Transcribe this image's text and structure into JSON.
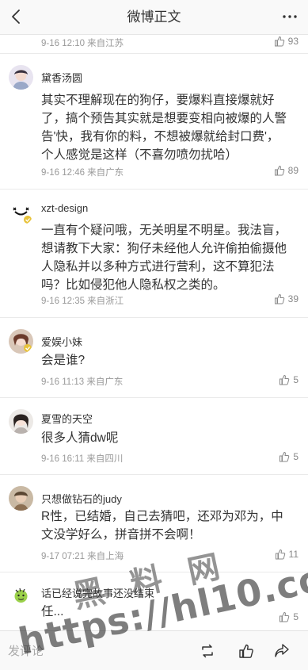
{
  "header": {
    "title": "微博正文",
    "back_icon": "chevron-left-icon",
    "more_icon": "more-dots-icon"
  },
  "partial_comment": {
    "meta": "9-16 12:10 来自江苏",
    "likes": "93"
  },
  "comments": [
    {
      "user": "黛香汤圆",
      "text": "其实不理解现在的狗仔，要爆料直接爆就好\n了，搞个预告其实就是想要变相向被爆的人警\n告'快，我有你的料，不想被爆就给封口费'，\n个人感觉是这样（不喜勿喷勿扰哈）",
      "meta": "9-16 12:46 来自广东",
      "likes": "89"
    },
    {
      "user": "xzt-design",
      "text": "一直有个疑问哦，无关明星不明星。我法盲，\n想请教下大家：狗仔未经他人允许偷拍偷摄他\n人隐私并以多种方式进行营利，这不算犯法\n吗？比如侵犯他人隐私权之类的。",
      "meta": "9-16 12:35 来自浙江",
      "likes": "39"
    },
    {
      "user": "爱娱小妹",
      "text": "会是谁?",
      "meta": "9-16 11:13 来自广东",
      "likes": "5"
    },
    {
      "user": "夏雪的天空",
      "text": "很多人猜dw呢",
      "meta": "9-16 16:11 来自四川",
      "likes": "5"
    },
    {
      "user": "只想做钻石的judy",
      "text": "R性，已结婚，自己去猜吧，还邓为邓为，中\n文没学好么，拼音拼不会啊！",
      "meta": "9-17 07:21 来自上海",
      "likes": "11"
    },
    {
      "user": "话已经说完故事还没结束",
      "text": "任...",
      "meta": "",
      "likes": "5"
    }
  ],
  "bottom_bar": {
    "reply_placeholder": "发评论",
    "icons": [
      "repost-icon",
      "like-icon",
      "share-icon"
    ]
  },
  "watermark": {
    "line1": "黑 料 网",
    "line2": "https://hl10.co"
  }
}
